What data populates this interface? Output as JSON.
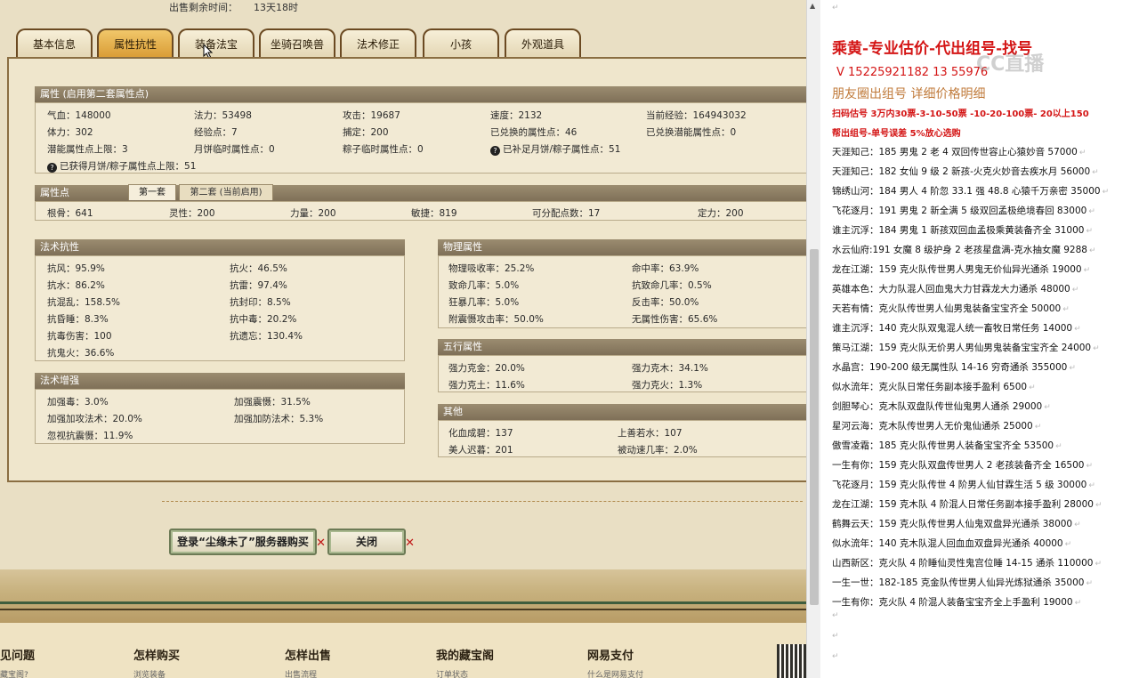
{
  "top": {
    "label": "出售剩余时间：",
    "value": "13天18时"
  },
  "tabs": [
    "基本信息",
    "属性抗性",
    "装备法宝",
    "坐骑召唤兽",
    "法术修正",
    "小孩",
    "外观道具"
  ],
  "attr": {
    "title": "属性 (启用第二套属性点)",
    "rows": [
      [
        "气血：148000",
        "法力：53498",
        "攻击：19687",
        "速度：2132",
        "当前经验：164943032"
      ],
      [
        "体力：302",
        "经验点：7",
        "捕定：200",
        "已兑换的属性点：46",
        "已兑换潜能属性点：0"
      ],
      [
        "潜能属性点上限：3",
        "月饼临时属性点：0",
        "粽子临时属性点：0",
        "已补足月饼/粽子属性点：51",
        ""
      ],
      [
        "已获得月饼/粽子属性点上限：51"
      ]
    ]
  },
  "points": {
    "title": "属性点",
    "tab1": "第一套",
    "tab2": "第二套 (当前启用)",
    "row": [
      "根骨：641",
      "灵性：200",
      "力量：200",
      "敏捷：819",
      "可分配点数：17",
      "定力：200"
    ]
  },
  "resist": {
    "title": "法术抗性",
    "rows": [
      [
        "抗风：95.9%",
        "抗火：46.5%"
      ],
      [
        "抗水：86.2%",
        "抗雷：97.4%"
      ],
      [
        "抗混乱：158.5%",
        "抗封印：8.5%"
      ],
      [
        "抗昏睡：8.3%",
        "抗中毒：20.2%"
      ],
      [
        "抗毒伤害：100",
        "抗遗忘：130.4%"
      ],
      [
        "抗鬼火：36.6%",
        ""
      ]
    ]
  },
  "enhance": {
    "title": "法术增强",
    "rows": [
      [
        "加强毒：3.0%",
        "加强震慑：31.5%"
      ],
      [
        "加强加攻法术：20.0%",
        "加强加防法术：5.3%"
      ],
      [
        "忽视抗震慑：11.9%",
        ""
      ]
    ]
  },
  "physical": {
    "title": "物理属性",
    "rows": [
      [
        "物理吸收率：25.2%",
        "命中率：63.9%"
      ],
      [
        "致命几率：5.0%",
        "抗致命几率：0.5%"
      ],
      [
        "狂暴几率：5.0%",
        "反击率：50.0%"
      ],
      [
        "附震慑攻击率：50.0%",
        "无属性伤害：65.6%"
      ]
    ]
  },
  "wuxing": {
    "title": "五行属性",
    "rows": [
      [
        "强力克金：20.0%",
        "强力克木：34.1%"
      ],
      [
        "强力克土：11.6%",
        "强力克火：1.3%"
      ]
    ]
  },
  "other": {
    "title": "其他",
    "rows": [
      [
        "化血成碧：137",
        "上善若水：107"
      ],
      [
        "美人迟暮：201",
        "被动速几率：2.0%"
      ]
    ]
  },
  "buttons": {
    "buy": "登录“尘缘未了”服务器购买",
    "close": "关闭"
  },
  "footer": [
    {
      "h": "见问题",
      "s": "藏宝阁?"
    },
    {
      "h": "怎样购买",
      "s": "浏览装备"
    },
    {
      "h": "怎样出售",
      "s": "出售流程"
    },
    {
      "h": "我的藏宝阁",
      "s": "订单状态"
    },
    {
      "h": "网易支付",
      "s": "什么是网易支付"
    }
  ],
  "right": {
    "title": "乘黄-专业估价-代出组号-找号",
    "phone": "V 15225921182    13   55976",
    "watermark": "CC直播",
    "subtitle": "朋友圈出组号    详细价格明细",
    "promo1": "扫码估号 3万内30票-3-10-50票 -10-20-100票- 20以上150",
    "promo2": "帮出组号-单号误差 5%放心选购",
    "list": [
      "天涯知己：185 男鬼 2 老 4 双回传世容止心猿妙音 57000",
      "天涯知己：182 女仙 9 级 2 新孩-火克火妙音去疾水月 56000",
      "锦绣山河：184 男人 4 阶忽 33.1 强 48.8 心猿千万亲密 35000",
      "飞花逐月：191 男鬼 2 新全满 5 级双回孟极绝境春回 83000",
      "谁主沉浮：184 男鬼 1 新孩双回血孟极乘黄装备齐全 31000",
      "水云仙府:191 女魔 8 级护身 2 老孩星盘满-克水抽女魔 9288",
      "龙在江湖：159 克火队传世男人男鬼无价仙异光通杀 19000",
      "英雄本色：大力队混人回血鬼大力甘霖龙大力通杀 48000",
      "天若有情：克火队传世男人仙男鬼装备宝宝齐全 50000",
      "谁主沉浮：140 克火队双鬼混人统一畜牧日常任务 14000",
      "策马江湖：159 克火队无价男人男仙男鬼装备宝宝齐全 24000",
      "水晶宫：190-200 级无属性队 14-16 穷奇通杀 355000",
      "似水流年：克火队日常任务副本接手盈利 6500",
      "剑胆琴心：克木队双盘队传世仙鬼男人通杀 29000",
      "星河云海：克木队传世男人无价鬼仙通杀 25000",
      "傲雪凌霜：185 克火队传世男人装备宝宝齐全 53500",
      "一生有你：159 克火队双盘传世男人 2 老孩装备齐全 16500",
      "飞花逐月：159 克火队传世 4 阶男人仙甘霖生活 5 级 30000",
      "龙在江湖：159 克木队 4 阶混人日常任务副本接手盈利 28000",
      "鹤舞云天：159 克火队传世男人仙鬼双盘异光通杀 38000",
      "似水流年：140 克木队混人回血血双盘异光通杀 40000",
      "山西新区：克火队 4 阶睡仙灵性鬼宫位睡 14-15 通杀 110000",
      "一生一世：182-185 克金队传世男人仙异光炼狱通杀 35000",
      "一生有你：克火队 4 阶混人装备宝宝齐全上手盈利 19000"
    ]
  }
}
